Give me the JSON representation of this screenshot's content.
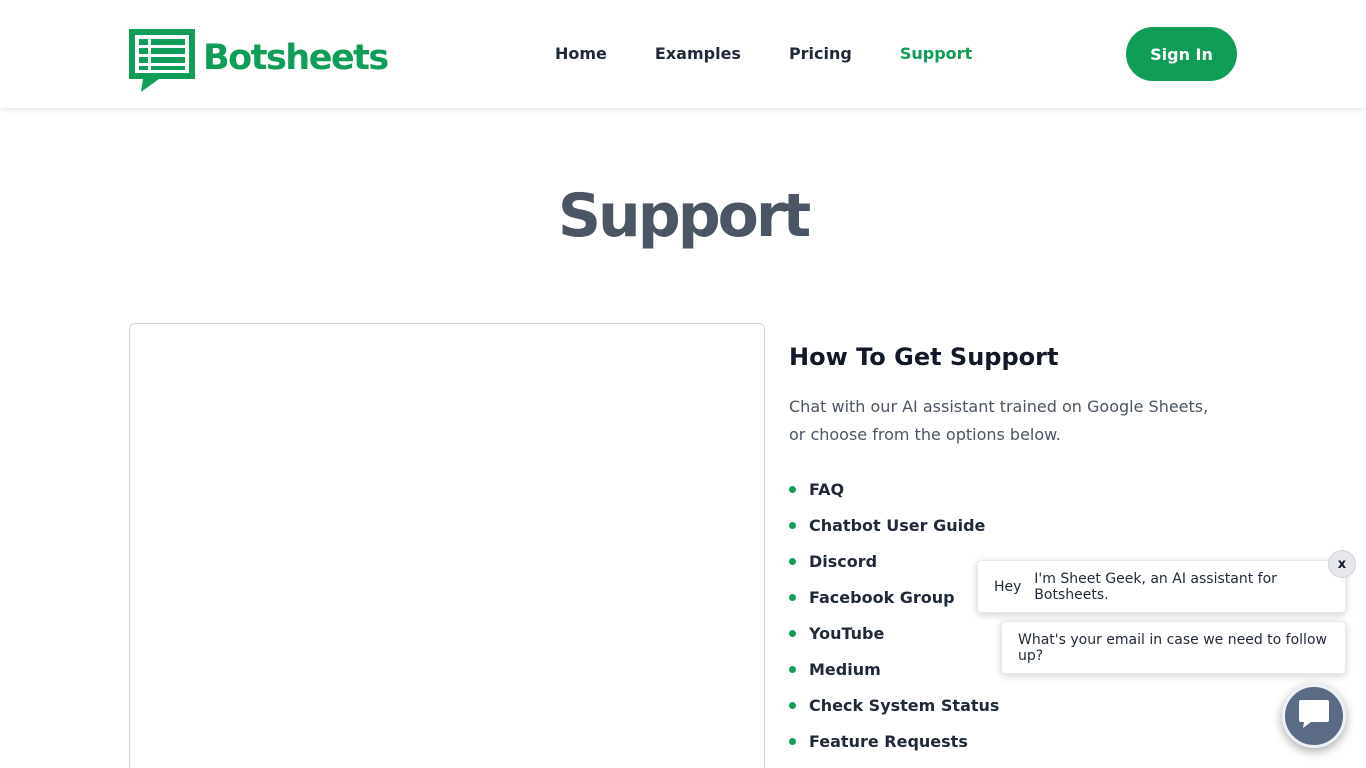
{
  "colors": {
    "brand_green": "#0f9d58",
    "title_gray": "#4b5563",
    "launcher": "#5b6b86"
  },
  "header": {
    "logo": {
      "icon": "sheet-chat-icon",
      "text": "Botsheets"
    },
    "nav": [
      {
        "label": "Home",
        "active": false
      },
      {
        "label": "Examples",
        "active": false
      },
      {
        "label": "Pricing",
        "active": false
      },
      {
        "label": "Support",
        "active": true
      }
    ],
    "signin_label": "Sign In"
  },
  "page": {
    "title": "Support"
  },
  "support": {
    "heading": "How To Get Support",
    "intro": "Chat with our AI assistant trained on Google Sheets, or choose from the options below.",
    "options": [
      "FAQ",
      "Chatbot User Guide",
      "Discord",
      "Facebook Group",
      "YouTube",
      "Medium",
      "Check System Status",
      "Feature Requests"
    ]
  },
  "chat": {
    "greeting_word": "Hey",
    "greeting_rest": "I'm Sheet Geek, an AI assistant for Botsheets.",
    "question": "What's your email in case we need to follow up?",
    "close_label": "x",
    "launcher_icon": "chat-bubble-icon"
  }
}
